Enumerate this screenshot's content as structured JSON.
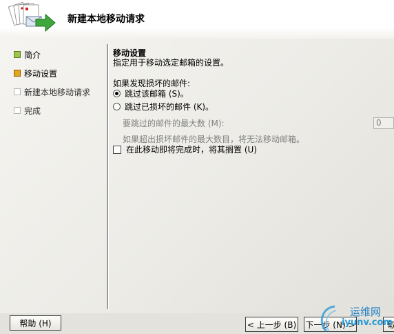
{
  "header": {
    "title": "新建本地移动请求"
  },
  "nav": {
    "items": [
      {
        "label": "简介",
        "state": "done"
      },
      {
        "label": "移动设置",
        "state": "current"
      },
      {
        "label": "新建本地移动请求",
        "state": "pending"
      },
      {
        "label": "完成",
        "state": "pending"
      }
    ]
  },
  "content": {
    "section_title": "移动设置",
    "section_desc": "指定用于移动选定邮箱的设置。",
    "group_label": "如果发现损坏的邮件:",
    "radio_skip_mailbox": "跳过该邮箱 (S)。",
    "radio_skip_corrupt": "跳过已损坏的邮件 (K)。",
    "max_count_label": "要跳过的邮件的最大数 (M):",
    "max_count_value": "0",
    "hint": "如果超出损坏邮件的最大数目，将无法移动邮箱。",
    "checkbox_suspend": "在此移动即将完成时，将其搁置 (U)"
  },
  "footer": {
    "help": "帮助 (H)",
    "back": "< 上一步 (B)",
    "next": "下一步 (N) >",
    "cancel_partial": "取"
  },
  "watermark": {
    "name": "运维网",
    "url": "iyunv.com"
  }
}
